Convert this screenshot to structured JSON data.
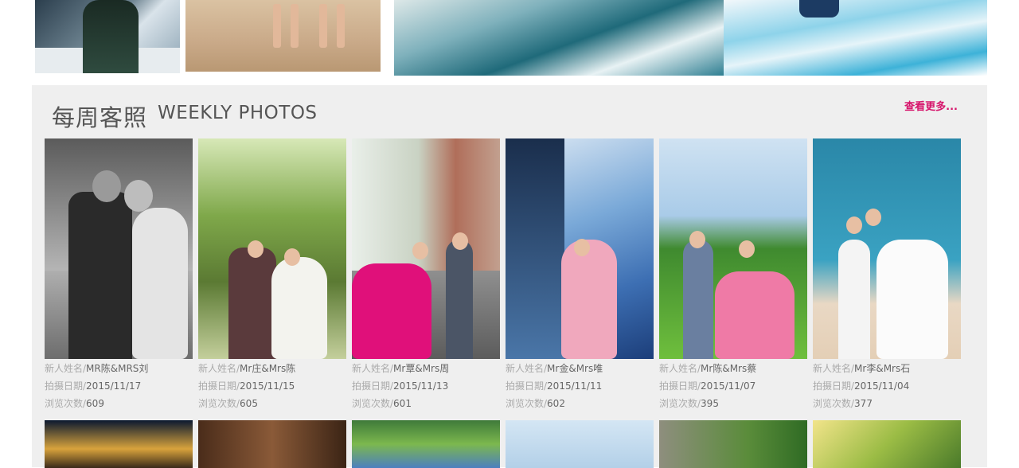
{
  "section": {
    "title_cn": "每周客照",
    "title_en": "WEEKLY PHOTOS",
    "more_label": "查看更多..."
  },
  "labels": {
    "name": "新人姓名/",
    "date": "拍摄日期/",
    "views": "浏览次数/"
  },
  "photos": [
    {
      "name": "MR陈&MRS刘",
      "date": "2015/11/17",
      "views": "609"
    },
    {
      "name": "Mr庄&Mrs陈",
      "date": "2015/11/15",
      "views": "605"
    },
    {
      "name": "Mr覃&Mrs周",
      "date": "2015/11/13",
      "views": "601"
    },
    {
      "name": "Mr金&Mrs唯",
      "date": "2015/11/11",
      "views": "602"
    },
    {
      "name": "Mr陈&Mrs蔡",
      "date": "2015/11/07",
      "views": "395"
    },
    {
      "name": "Mr李&Mrs石",
      "date": "2015/11/04",
      "views": "377"
    }
  ],
  "colors": {
    "accent": "#d6146b",
    "panel": "#efefef",
    "label": "#aaaaaa",
    "value": "#666666"
  }
}
